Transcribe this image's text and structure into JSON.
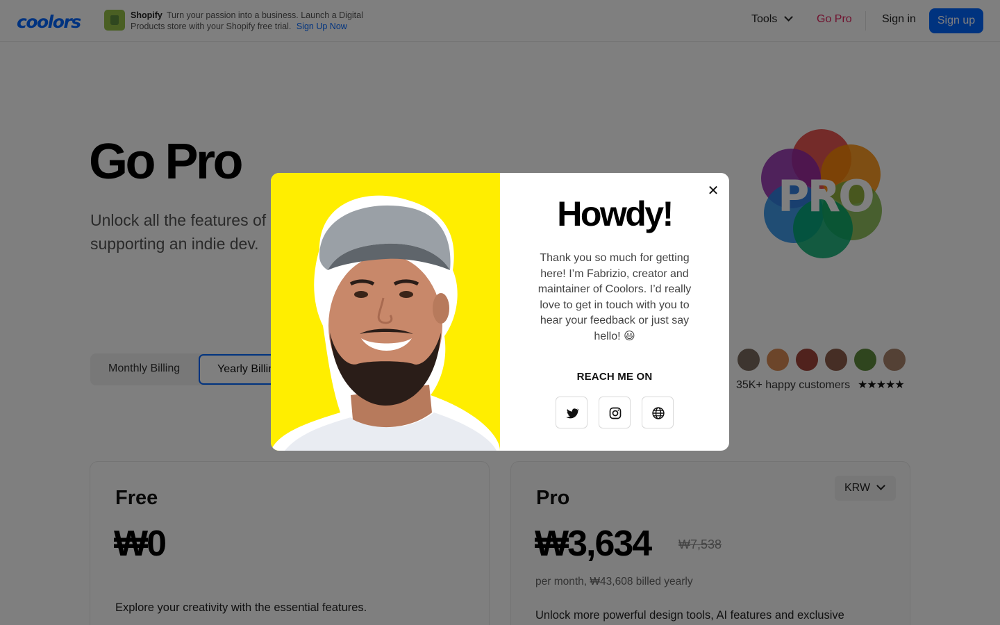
{
  "header": {
    "logo": "coolors",
    "ad": {
      "brand": "Shopify",
      "text": "Turn your passion into a business. Launch a Digital Products store with your Shopify free trial.",
      "link": "Sign Up Now"
    },
    "nav": {
      "tools": "Tools",
      "go_pro": "Go Pro",
      "sign_in": "Sign in",
      "sign_up": "Sign up"
    }
  },
  "page": {
    "title": "Go Pro",
    "subtitle": "Unlock all the features of Coolors, supporting an indie dev.",
    "pro_logo_text": "PRO",
    "billing": {
      "monthly": "Monthly Billing",
      "yearly": "Yearly Billing"
    },
    "customers": {
      "label": "35K+ happy customers",
      "stars": "★★★★★",
      "rating": 5
    },
    "plans": {
      "free": {
        "name": "Free",
        "price": "₩0",
        "description": "Explore your creativity with the essential features."
      },
      "pro": {
        "name": "Pro",
        "price": "₩3,634",
        "old_price": "₩7,538",
        "period": "per month, ₩43,608 billed yearly",
        "description": "Unlock more powerful design tools, AI features and exclusive",
        "currency": "KRW"
      }
    }
  },
  "modal": {
    "close": "✕",
    "title": "Howdy!",
    "text": "Thank you so much for getting here! I’m Fabrizio, creator and maintainer of Coolors. I’d really love to get in touch with you to hear your feedback or just say hello! 😃",
    "reach_label": "REACH ME ON",
    "socials": [
      "twitter-icon",
      "instagram-icon",
      "globe-icon"
    ]
  },
  "colors": {
    "brand_blue": "#0066ff",
    "go_pro_pink": "#e0245e",
    "modal_yellow": "#ffee00"
  }
}
